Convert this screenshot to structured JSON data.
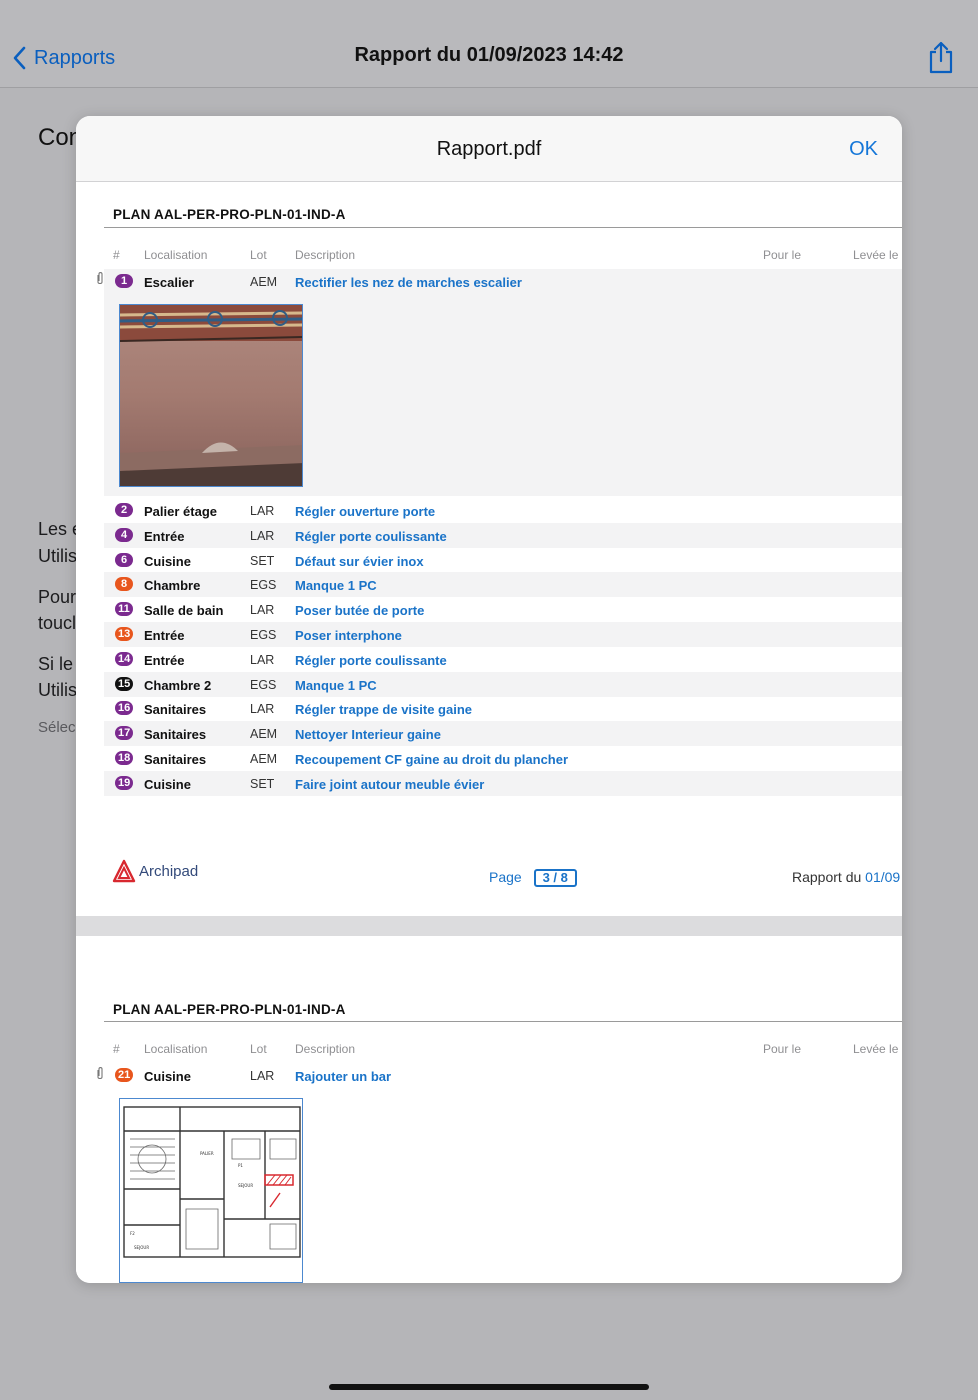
{
  "navbar": {
    "back_label": "Rapports",
    "title": "Rapport du 01/09/2023 14:42",
    "share_icon": "share-icon"
  },
  "background": {
    "heading": "Con",
    "lines": [
      "Les é",
      "Utilis",
      "Pour",
      "toucl",
      "Si le",
      "Utilis"
    ],
    "small": "Sélec"
  },
  "modal": {
    "title": "Rapport.pdf",
    "ok_label": "OK"
  },
  "pdf": {
    "columns": {
      "num": "#",
      "localisation": "Localisation",
      "lot": "Lot",
      "description": "Description",
      "pour_le": "Pour le",
      "levee_le": "Levée le"
    },
    "page1": {
      "plan_title": "PLAN AAL-PER-PRO-PLN-01-IND-A",
      "first_item": {
        "num": "1",
        "color": "#7b2a8f",
        "localisation": "Escalier",
        "lot": "AEM",
        "description": "Rectifier les nez de marches escalier"
      },
      "items": [
        {
          "num": "2",
          "color": "#7b2a8f",
          "localisation": "Palier étage",
          "lot": "LAR",
          "description": "Régler ouverture porte"
        },
        {
          "num": "4",
          "color": "#7b2a8f",
          "localisation": "Entrée",
          "lot": "LAR",
          "description": "Régler porte coulissante"
        },
        {
          "num": "6",
          "color": "#7b2a8f",
          "localisation": "Cuisine",
          "lot": "SET",
          "description": "Défaut sur évier inox"
        },
        {
          "num": "8",
          "color": "#e8561d",
          "localisation": "Chambre",
          "lot": "EGS",
          "description": "Manque 1 PC"
        },
        {
          "num": "11",
          "color": "#7b2a8f",
          "localisation": "Salle de bain",
          "lot": "LAR",
          "description": "Poser butée de porte"
        },
        {
          "num": "13",
          "color": "#e8561d",
          "localisation": "Entrée",
          "lot": "EGS",
          "description": "Poser interphone"
        },
        {
          "num": "14",
          "color": "#7b2a8f",
          "localisation": "Entrée",
          "lot": "LAR",
          "description": "Régler porte coulissante"
        },
        {
          "num": "15",
          "color": "#111111",
          "localisation": "Chambre 2",
          "lot": "EGS",
          "description": "Manque 1 PC"
        },
        {
          "num": "16",
          "color": "#7b2a8f",
          "localisation": "Sanitaires",
          "lot": "LAR",
          "description": "Régler trappe de visite gaine"
        },
        {
          "num": "17",
          "color": "#7b2a8f",
          "localisation": "Sanitaires",
          "lot": "AEM",
          "description": "Nettoyer Interieur gaine"
        },
        {
          "num": "18",
          "color": "#7b2a8f",
          "localisation": "Sanitaires",
          "lot": "AEM",
          "description": "Recoupement CF gaine au droit du plancher"
        },
        {
          "num": "19",
          "color": "#7b2a8f",
          "localisation": "Cuisine",
          "lot": "SET",
          "description": "Faire joint autour meuble évier"
        }
      ],
      "footer": {
        "logo_text": "Archipad",
        "page_label": "Page",
        "page_value": "3 / 8",
        "report_label": "Rapport du",
        "report_date": "01/09"
      }
    },
    "page2": {
      "plan_title": "PLAN AAL-PER-PRO-PLN-01-IND-A",
      "first_item": {
        "num": "21",
        "color": "#e8561d",
        "localisation": "Cuisine",
        "lot": "LAR",
        "description": "Rajouter un bar"
      }
    }
  }
}
